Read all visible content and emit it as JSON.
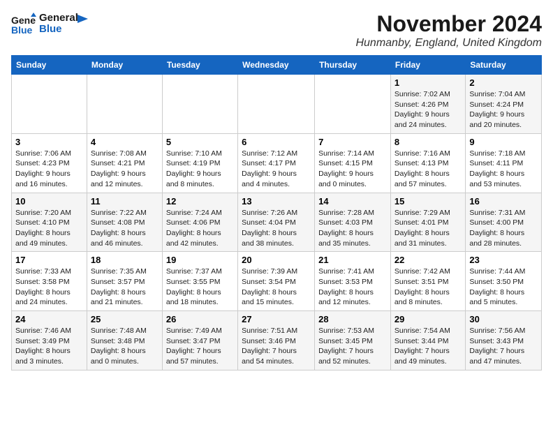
{
  "header": {
    "logo_line1": "General",
    "logo_line2": "Blue",
    "month": "November 2024",
    "location": "Hunmanby, England, United Kingdom"
  },
  "weekdays": [
    "Sunday",
    "Monday",
    "Tuesday",
    "Wednesday",
    "Thursday",
    "Friday",
    "Saturday"
  ],
  "weeks": [
    [
      {
        "day": "",
        "info": ""
      },
      {
        "day": "",
        "info": ""
      },
      {
        "day": "",
        "info": ""
      },
      {
        "day": "",
        "info": ""
      },
      {
        "day": "",
        "info": ""
      },
      {
        "day": "1",
        "info": "Sunrise: 7:02 AM\nSunset: 4:26 PM\nDaylight: 9 hours and 24 minutes."
      },
      {
        "day": "2",
        "info": "Sunrise: 7:04 AM\nSunset: 4:24 PM\nDaylight: 9 hours and 20 minutes."
      }
    ],
    [
      {
        "day": "3",
        "info": "Sunrise: 7:06 AM\nSunset: 4:23 PM\nDaylight: 9 hours and 16 minutes."
      },
      {
        "day": "4",
        "info": "Sunrise: 7:08 AM\nSunset: 4:21 PM\nDaylight: 9 hours and 12 minutes."
      },
      {
        "day": "5",
        "info": "Sunrise: 7:10 AM\nSunset: 4:19 PM\nDaylight: 9 hours and 8 minutes."
      },
      {
        "day": "6",
        "info": "Sunrise: 7:12 AM\nSunset: 4:17 PM\nDaylight: 9 hours and 4 minutes."
      },
      {
        "day": "7",
        "info": "Sunrise: 7:14 AM\nSunset: 4:15 PM\nDaylight: 9 hours and 0 minutes."
      },
      {
        "day": "8",
        "info": "Sunrise: 7:16 AM\nSunset: 4:13 PM\nDaylight: 8 hours and 57 minutes."
      },
      {
        "day": "9",
        "info": "Sunrise: 7:18 AM\nSunset: 4:11 PM\nDaylight: 8 hours and 53 minutes."
      }
    ],
    [
      {
        "day": "10",
        "info": "Sunrise: 7:20 AM\nSunset: 4:10 PM\nDaylight: 8 hours and 49 minutes."
      },
      {
        "day": "11",
        "info": "Sunrise: 7:22 AM\nSunset: 4:08 PM\nDaylight: 8 hours and 46 minutes."
      },
      {
        "day": "12",
        "info": "Sunrise: 7:24 AM\nSunset: 4:06 PM\nDaylight: 8 hours and 42 minutes."
      },
      {
        "day": "13",
        "info": "Sunrise: 7:26 AM\nSunset: 4:04 PM\nDaylight: 8 hours and 38 minutes."
      },
      {
        "day": "14",
        "info": "Sunrise: 7:28 AM\nSunset: 4:03 PM\nDaylight: 8 hours and 35 minutes."
      },
      {
        "day": "15",
        "info": "Sunrise: 7:29 AM\nSunset: 4:01 PM\nDaylight: 8 hours and 31 minutes."
      },
      {
        "day": "16",
        "info": "Sunrise: 7:31 AM\nSunset: 4:00 PM\nDaylight: 8 hours and 28 minutes."
      }
    ],
    [
      {
        "day": "17",
        "info": "Sunrise: 7:33 AM\nSunset: 3:58 PM\nDaylight: 8 hours and 24 minutes."
      },
      {
        "day": "18",
        "info": "Sunrise: 7:35 AM\nSunset: 3:57 PM\nDaylight: 8 hours and 21 minutes."
      },
      {
        "day": "19",
        "info": "Sunrise: 7:37 AM\nSunset: 3:55 PM\nDaylight: 8 hours and 18 minutes."
      },
      {
        "day": "20",
        "info": "Sunrise: 7:39 AM\nSunset: 3:54 PM\nDaylight: 8 hours and 15 minutes."
      },
      {
        "day": "21",
        "info": "Sunrise: 7:41 AM\nSunset: 3:53 PM\nDaylight: 8 hours and 12 minutes."
      },
      {
        "day": "22",
        "info": "Sunrise: 7:42 AM\nSunset: 3:51 PM\nDaylight: 8 hours and 8 minutes."
      },
      {
        "day": "23",
        "info": "Sunrise: 7:44 AM\nSunset: 3:50 PM\nDaylight: 8 hours and 5 minutes."
      }
    ],
    [
      {
        "day": "24",
        "info": "Sunrise: 7:46 AM\nSunset: 3:49 PM\nDaylight: 8 hours and 3 minutes."
      },
      {
        "day": "25",
        "info": "Sunrise: 7:48 AM\nSunset: 3:48 PM\nDaylight: 8 hours and 0 minutes."
      },
      {
        "day": "26",
        "info": "Sunrise: 7:49 AM\nSunset: 3:47 PM\nDaylight: 7 hours and 57 minutes."
      },
      {
        "day": "27",
        "info": "Sunrise: 7:51 AM\nSunset: 3:46 PM\nDaylight: 7 hours and 54 minutes."
      },
      {
        "day": "28",
        "info": "Sunrise: 7:53 AM\nSunset: 3:45 PM\nDaylight: 7 hours and 52 minutes."
      },
      {
        "day": "29",
        "info": "Sunrise: 7:54 AM\nSunset: 3:44 PM\nDaylight: 7 hours and 49 minutes."
      },
      {
        "day": "30",
        "info": "Sunrise: 7:56 AM\nSunset: 3:43 PM\nDaylight: 7 hours and 47 minutes."
      }
    ]
  ]
}
